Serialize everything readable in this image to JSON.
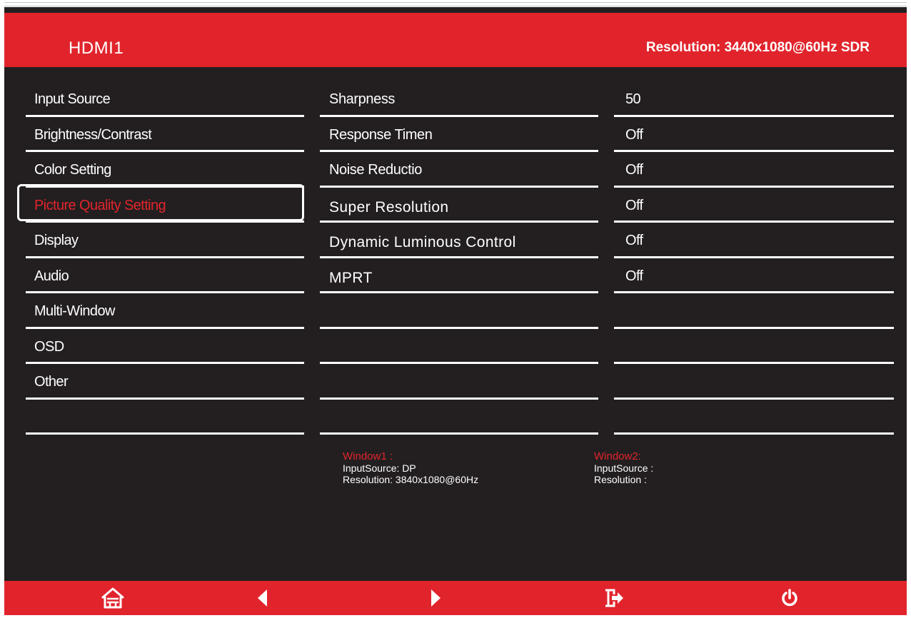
{
  "header": {
    "input_name": "HDMI1",
    "resolution": "Resolution: 3440x1080@60Hz SDR"
  },
  "menu": {
    "items": [
      {
        "label": "Input Source"
      },
      {
        "label": "Brightness/Contrast"
      },
      {
        "label": "Color Setting"
      },
      {
        "label": "Picture Quality Setting",
        "selected": true
      },
      {
        "label": "Display"
      },
      {
        "label": "Audio"
      },
      {
        "label": "Multi-Window"
      },
      {
        "label": "OSD"
      },
      {
        "label": "Other"
      },
      {
        "label": ""
      }
    ]
  },
  "settings": {
    "names": [
      "Sharpness",
      "Response Timen",
      "Noise Reductio",
      "Super Resolution",
      "Dynamic Luminous Control",
      "MPRT",
      "",
      "",
      "",
      ""
    ],
    "values": [
      "50",
      "Off",
      "Off",
      "Off",
      "Off",
      "Off",
      "",
      "",
      "",
      ""
    ]
  },
  "window1": {
    "title": "Window1 :",
    "input_source": "InputSource: DP",
    "resolution": "Resolution: 3840x1080@60Hz"
  },
  "window2": {
    "title": "Window2:",
    "input_source": "InputSource :",
    "resolution": "Resolution :"
  },
  "footer": {
    "buttons": [
      "home-icon",
      "left-arrow-icon",
      "right-arrow-icon",
      "exit-icon",
      "power-icon"
    ]
  },
  "colors": {
    "accent": "#e1242c",
    "background": "#231f20",
    "text": "#ffffff"
  }
}
